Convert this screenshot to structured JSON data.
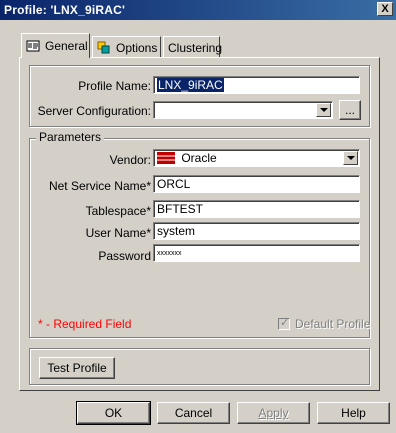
{
  "window": {
    "title": "Profile: 'LNX_9iRAC'",
    "close_label": "X"
  },
  "tabs": [
    {
      "label": "General",
      "icon": "profile-icon",
      "active": true
    },
    {
      "label": "Options",
      "icon": "options-icon",
      "active": false
    },
    {
      "label": "Clustering",
      "icon": "",
      "active": false
    }
  ],
  "general": {
    "profile_name_label": "Profile Name:",
    "profile_name_value": "LNX_9iRAC",
    "server_config_label": "Server Configuration:",
    "server_config_value": "",
    "browse_label": "..."
  },
  "parameters": {
    "legend": "Parameters",
    "vendor_label": "Vendor:",
    "vendor_value": "Oracle",
    "net_service_label": "Net Service Name*",
    "net_service_value": "ORCL",
    "tablespace_label": "Tablespace*",
    "tablespace_value": "BFTEST",
    "user_name_label": "User Name*",
    "user_name_value": "system",
    "password_label": "Password",
    "password_value": "xxxxxxx",
    "required_note": "* - Required Field",
    "default_profile_label": "Default Profile"
  },
  "test": {
    "label": "Test Profile"
  },
  "footer": {
    "ok": "OK",
    "cancel": "Cancel",
    "apply": "Apply",
    "help": "Help"
  },
  "colors": {
    "title_bg": "#0a246a",
    "required_red": "#ff0000",
    "face": "#d4d0c8"
  }
}
